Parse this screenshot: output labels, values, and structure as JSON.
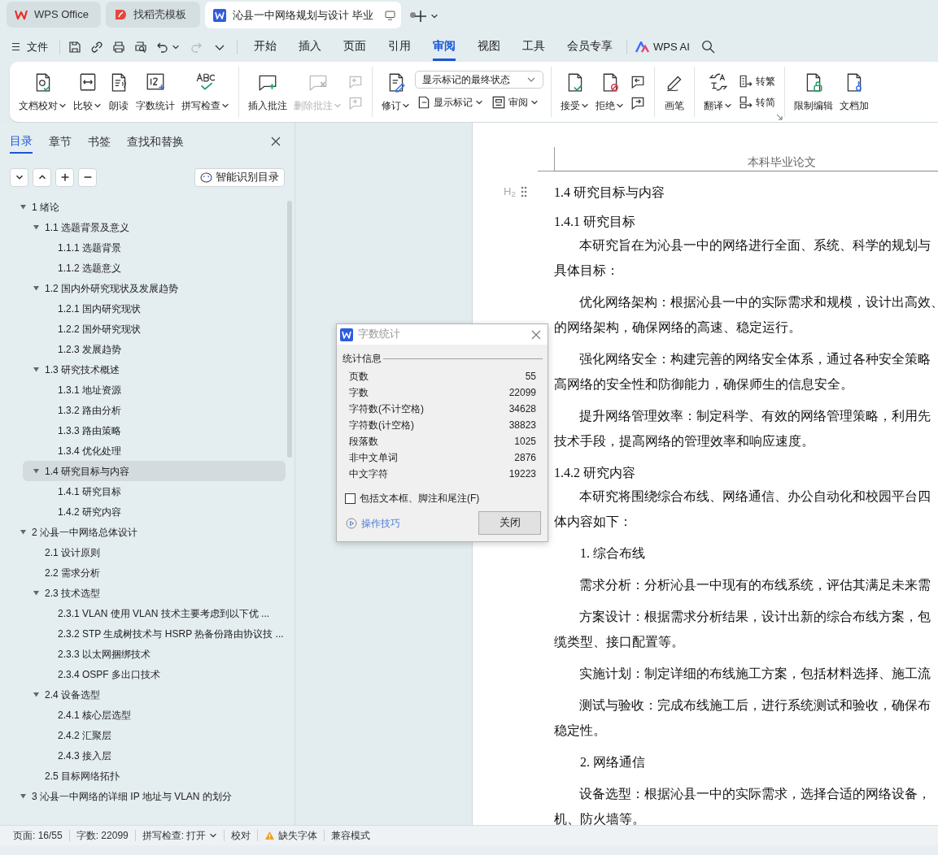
{
  "tabs": [
    {
      "kind": "home",
      "label": "WPS Office",
      "selected": false
    },
    {
      "kind": "template",
      "label": "找稻壳模板",
      "selected": false
    },
    {
      "kind": "document",
      "label": "沁县一中网络规划与设计 毕业",
      "selected": true
    }
  ],
  "menu": {
    "file": "文件",
    "tabs": [
      {
        "label": "开始",
        "selected": false
      },
      {
        "label": "插入",
        "selected": false
      },
      {
        "label": "页面",
        "selected": false
      },
      {
        "label": "引用",
        "selected": false
      },
      {
        "label": "审阅",
        "selected": true
      },
      {
        "label": "视图",
        "selected": false
      },
      {
        "label": "工具",
        "selected": false
      },
      {
        "label": "会员专享",
        "selected": false
      }
    ],
    "ai": "WPS AI"
  },
  "ribbon": {
    "groups": [
      {
        "items": [
          {
            "kind": "big",
            "label": "文档校对",
            "dropdown": true,
            "disabled": false
          },
          {
            "kind": "big",
            "label": "比较",
            "dropdown": true,
            "disabled": false
          },
          {
            "kind": "big",
            "label": "朗读",
            "dropdown": false,
            "disabled": false
          },
          {
            "kind": "big",
            "label": "字数统计",
            "dropdown": false,
            "disabled": false
          },
          {
            "kind": "big",
            "label": "拼写检查",
            "dropdown": true,
            "disabled": false
          }
        ]
      },
      {
        "items": [
          {
            "kind": "big",
            "label": "插入批注",
            "dropdown": false,
            "disabled": false
          },
          {
            "kind": "big",
            "label": "删除批注",
            "dropdown": true,
            "disabled": true
          },
          {
            "kind": "stack",
            "rows": [
              [
                {
                  "kind": "small",
                  "dropdown": false,
                  "disabled": true
                }
              ],
              [
                {
                  "kind": "small",
                  "dropdown": false,
                  "disabled": true
                }
              ]
            ]
          }
        ]
      },
      {
        "items": [
          {
            "kind": "big",
            "label": "修订",
            "dropdown": true,
            "disabled": false
          },
          {
            "kind": "stack",
            "rows": [
              [
                {
                  "kind": "select",
                  "value": "显示标记的最终状态"
                }
              ],
              [
                {
                  "kind": "small",
                  "label": "显示标记",
                  "dropdown": true,
                  "disabled": false
                },
                {
                  "kind": "small",
                  "label": "审阅",
                  "dropdown": true,
                  "disabled": false
                }
              ]
            ]
          }
        ]
      },
      {
        "items": [
          {
            "kind": "big",
            "label": "接受",
            "dropdown": true,
            "disabled": false
          },
          {
            "kind": "big",
            "label": "拒绝",
            "dropdown": true,
            "disabled": false
          },
          {
            "kind": "stack",
            "rows": [
              [
                {
                  "kind": "small",
                  "dropdown": false,
                  "disabled": false
                }
              ],
              [
                {
                  "kind": "small",
                  "dropdown": false,
                  "disabled": false
                }
              ]
            ]
          }
        ]
      },
      {
        "items": [
          {
            "kind": "big",
            "label": "画笔",
            "dropdown": false,
            "disabled": false
          }
        ]
      },
      {
        "launcher": true,
        "items": [
          {
            "kind": "big",
            "label": "翻译",
            "dropdown": true,
            "disabled": false
          },
          {
            "kind": "stack",
            "rows": [
              [
                {
                  "kind": "small",
                  "label": "转繁",
                  "dropdown": false,
                  "disabled": false
                }
              ],
              [
                {
                  "kind": "small",
                  "label": "转简",
                  "dropdown": false,
                  "disabled": false
                }
              ]
            ]
          }
        ]
      },
      {
        "items": [
          {
            "kind": "big",
            "label": "限制编辑",
            "dropdown": false,
            "disabled": false
          },
          {
            "kind": "big",
            "label": "文档加",
            "dropdown": false,
            "disabled": false
          }
        ]
      }
    ]
  },
  "nav": {
    "tabs": [
      {
        "label": "目录",
        "selected": true
      },
      {
        "label": "章节",
        "selected": false
      },
      {
        "label": "书签",
        "selected": false
      },
      {
        "label": "查找和替换",
        "selected": false
      }
    ],
    "smart_button": "智能识别目录",
    "toc": [
      {
        "text": "1  绪论",
        "expanded": true,
        "selected": false,
        "children": [
          {
            "text": "1.1 选题背景及意义",
            "expanded": true,
            "selected": false,
            "children": [
              {
                "text": "1.1.1 选题背景",
                "selected": false
              },
              {
                "text": "1.1.2 选题意义",
                "selected": false
              }
            ]
          },
          {
            "text": "1.2 国内外研究现状及发展趋势",
            "expanded": true,
            "selected": false,
            "children": [
              {
                "text": "1.2.1 国内研究现状",
                "selected": false
              },
              {
                "text": "1.2.2 国外研究现状",
                "selected": false
              },
              {
                "text": "1.2.3 发展趋势",
                "selected": false
              }
            ]
          },
          {
            "text": "1.3 研究技术概述",
            "expanded": true,
            "selected": false,
            "children": [
              {
                "text": "1.3.1 地址资源",
                "selected": false
              },
              {
                "text": "1.3.2 路由分析",
                "selected": false
              },
              {
                "text": "1.3.3 路由策略",
                "selected": false
              },
              {
                "text": "1.3.4 优化处理",
                "selected": false
              }
            ]
          },
          {
            "text": "1.4 研究目标与内容",
            "expanded": true,
            "selected": true,
            "children": [
              {
                "text": "1.4.1 研究目标",
                "selected": false
              },
              {
                "text": "1.4.2 研究内容",
                "selected": false
              }
            ]
          }
        ]
      },
      {
        "text": "2  沁县一中网络总体设计",
        "expanded": true,
        "selected": false,
        "children": [
          {
            "text": "2.1 设计原则",
            "selected": false
          },
          {
            "text": "2.2 需求分析",
            "selected": false
          },
          {
            "text": "2.3 技术选型",
            "expanded": true,
            "selected": false,
            "children": [
              {
                "text": "2.3.1 VLAN  使用 VLAN 技术主要考虑到以下优 ...",
                "selected": false
              },
              {
                "text": "2.3.2 STP 生成树技术与 HSRP 热备份路由协议技 ...",
                "selected": false
              },
              {
                "text": "2.3.3 以太网捆绑技术",
                "selected": false
              },
              {
                "text": "2.3.4 OSPF 多出口技术",
                "selected": false
              }
            ]
          },
          {
            "text": "2.4 设备选型",
            "expanded": true,
            "selected": false,
            "children": [
              {
                "text": "2.4.1 核心层选型",
                "selected": false
              },
              {
                "text": "2.4.2 汇聚层",
                "selected": false
              },
              {
                "text": "2.4.3 接入层",
                "selected": false
              }
            ]
          },
          {
            "text": "2.5 目标网络拓扑",
            "selected": false
          }
        ]
      },
      {
        "text": "3  沁县一中网络的详细 IP 地址与 VLAN 的划分",
        "expanded": true,
        "selected": false
      }
    ]
  },
  "document": {
    "header": "本科毕业论文",
    "heading_marker": "H$_{2}$",
    "blocks": [
      {
        "kind": "h2",
        "text": "1.4 研究目标与内容"
      },
      {
        "kind": "h3",
        "text": "1.4.1 研究目标"
      },
      {
        "kind": "para",
        "lines": [
          "本研究旨在为沁县一中的网络进行全面、系统、科学的规划与",
          "具体目标："
        ]
      },
      {
        "kind": "para",
        "lines": [
          "优化网络架构：根据沁县一中的实际需求和规模，设计出高效、",
          "的网络架构，确保网络的高速、稳定运行。"
        ]
      },
      {
        "kind": "para",
        "lines": [
          "强化网络安全：构建完善的网络安全体系，通过各种安全策略",
          "高网络的安全性和防御能力，确保师生的信息安全。"
        ]
      },
      {
        "kind": "para",
        "lines": [
          "提升网络管理效率：制定科学、有效的网络管理策略，利用先",
          "技术手段，提高网络的管理效率和响应速度。"
        ]
      },
      {
        "kind": "h3",
        "text": "1.4.2 研究内容"
      },
      {
        "kind": "para",
        "lines": [
          "本研究将围绕综合布线、网络通信、办公自动化和校园平台四",
          "体内容如下："
        ]
      },
      {
        "kind": "list",
        "text": "1.  综合布线"
      },
      {
        "kind": "para",
        "lines": [
          "需求分析：分析沁县一中现有的布线系统，评估其满足未来需"
        ]
      },
      {
        "kind": "para",
        "lines": [
          "方案设计：根据需求分析结果，设计出新的综合布线方案，包",
          "缆类型、接口配置等。"
        ]
      },
      {
        "kind": "para",
        "lines": [
          "实施计划：制定详细的布线施工方案，包括材料选择、施工流"
        ]
      },
      {
        "kind": "para",
        "lines": [
          "测试与验收：完成布线施工后，进行系统测试和验收，确保布",
          "稳定性。"
        ]
      },
      {
        "kind": "list",
        "text": "2.  网络通信"
      },
      {
        "kind": "para",
        "lines": [
          "设备选型：根据沁县一中的实际需求，选择合适的网络设备，",
          "机、防火墙等。"
        ]
      }
    ]
  },
  "dialog": {
    "title": "字数统计",
    "group": "统计信息",
    "stats": [
      {
        "label": "页数",
        "value": "55"
      },
      {
        "label": "字数",
        "value": "22099"
      },
      {
        "label": "字符数(不计空格)",
        "value": "34628"
      },
      {
        "label": "字符数(计空格)",
        "value": "38823"
      },
      {
        "label": "段落数",
        "value": "1025"
      },
      {
        "label": "非中文单词",
        "value": "2876"
      },
      {
        "label": "中文字符",
        "value": "19223"
      }
    ],
    "checkbox": {
      "label": "包括文本框、脚注和尾注(F)",
      "checked": false
    },
    "tips": "操作技巧",
    "close": "关闭"
  },
  "status_bar": [
    {
      "kind": "text",
      "label": "页面: 16/55"
    },
    {
      "kind": "text",
      "label": "字数: 22099"
    },
    {
      "kind": "dropdown",
      "label": "拼写检查: 打开"
    },
    {
      "kind": "text",
      "label": "校对"
    },
    {
      "kind": "warning",
      "label": "缺失字体"
    },
    {
      "kind": "text",
      "label": "兼容模式"
    }
  ]
}
